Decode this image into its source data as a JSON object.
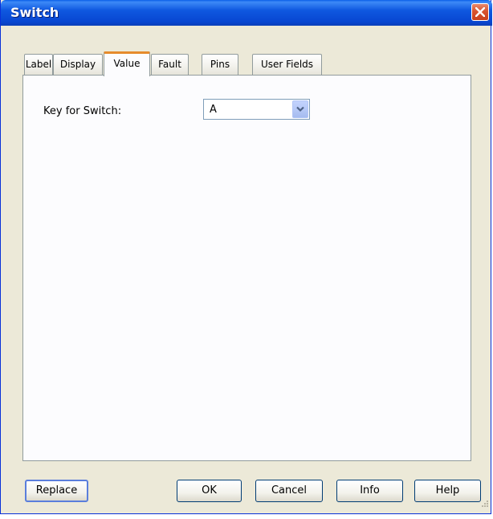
{
  "window": {
    "title": "Switch"
  },
  "tabs": [
    {
      "label": "Label"
    },
    {
      "label": "Display"
    },
    {
      "label": "Value"
    },
    {
      "label": "Fault"
    },
    {
      "label": "Pins"
    },
    {
      "label": "User Fields"
    }
  ],
  "active_tab": "Value",
  "value_tab": {
    "key_label": "Key for Switch:",
    "key_value": "A"
  },
  "buttons": {
    "replace": "Replace",
    "ok": "OK",
    "cancel": "Cancel",
    "info": "Info",
    "help": "Help"
  },
  "icons": {
    "close": "close-icon",
    "dropdown": "chevron-down-icon",
    "resize": "resize-grip-icon"
  },
  "colors": {
    "titlebar": "#0846d1",
    "close_button": "#d8532e",
    "active_tab_accent": "#e68b2c",
    "dialog_bg": "#ece9d8"
  }
}
